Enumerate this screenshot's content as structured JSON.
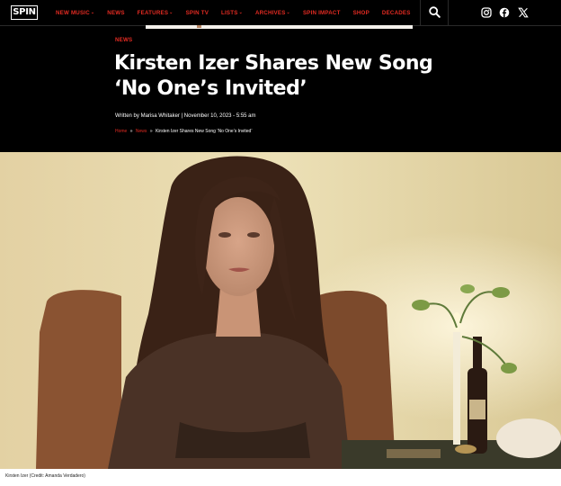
{
  "site": {
    "logo_text": "SPIN"
  },
  "nav": {
    "items": [
      {
        "label": "NEW MUSIC",
        "has_dropdown": true
      },
      {
        "label": "NEWS",
        "has_dropdown": false
      },
      {
        "label": "FEATURES",
        "has_dropdown": true
      },
      {
        "label": "SPIN TV",
        "has_dropdown": false
      },
      {
        "label": "LISTS",
        "has_dropdown": true
      },
      {
        "label": "ARCHIVES",
        "has_dropdown": true
      },
      {
        "label": "SPIN IMPACT",
        "has_dropdown": false
      },
      {
        "label": "SHOP",
        "has_dropdown": false
      },
      {
        "label": "DECADES",
        "has_dropdown": false
      }
    ],
    "search_icon": "search-icon",
    "social_icons": [
      "instagram-icon",
      "facebook-icon",
      "x-icon"
    ]
  },
  "article": {
    "category": "NEWS",
    "headline_line1": "Kirsten Izer Shares New Song",
    "headline_line2": "‘No One’s Invited’",
    "byline": "Written by Marisa Whitaker | November 10, 2023 - 5:55 am",
    "breadcrumb": {
      "home": "Home",
      "sep": "»",
      "section": "News",
      "current": "Kirsten Izer Shares New Song ‘No One’s Invited’"
    },
    "image_caption": "Kirsten Izer (Credit: Amanda Verdadero)"
  },
  "colors": {
    "accent": "#e32b22",
    "background": "#000000",
    "text": "#ffffff"
  }
}
